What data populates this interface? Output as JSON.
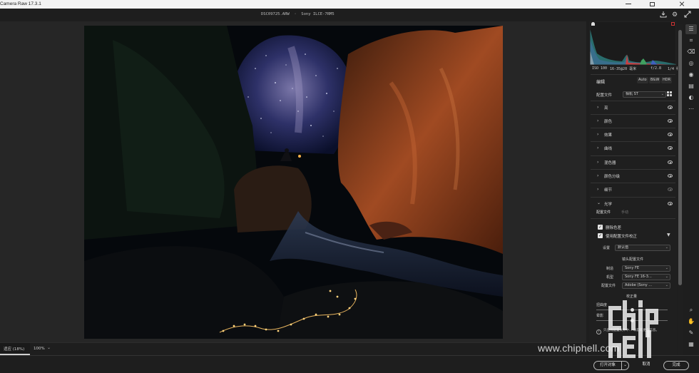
{
  "window": {
    "app_title": "Camera Raw 17.3.1"
  },
  "toolbar": {
    "filename": "DSC09725.ARW  ·  Sony ILCE-7RM5",
    "icons": [
      "save-icon",
      "gear-icon",
      "fullscreen-icon"
    ]
  },
  "histogram": {
    "iso": "ISO 100",
    "focal": "16-35@20 毫米",
    "aperture": "f/2.8",
    "shutter": "1/4 秒"
  },
  "edit_panel": {
    "title": "编辑",
    "buttons": [
      "Auto",
      "B&W",
      "HDR"
    ],
    "profile_label": "配置文件",
    "profile_value": "相机 ST",
    "sections": [
      {
        "label": "亮"
      },
      {
        "label": "颜色"
      },
      {
        "label": "效果"
      },
      {
        "label": "曲线"
      },
      {
        "label": "混色器"
      },
      {
        "label": "颜色分级"
      },
      {
        "label": "细节"
      },
      {
        "label": "光学"
      }
    ],
    "optics": {
      "tab_profile": "配置文件",
      "tab_manual": "手动",
      "remove_ca": "删除色差",
      "use_profile": "使用配置文件校正",
      "setup_label": "设置",
      "setup_value": "默认值",
      "lens_profile_heading": "镜头配置文件",
      "make_label": "制造",
      "make_value": "Sony FE",
      "model_label": "机型",
      "model_value": "Sony FE 16-3…",
      "profile_label": "配置文件",
      "profile_value": "Adobe (Sony …",
      "correction_heading": "校正量",
      "distortion_label": "扭曲度",
      "vignette_label": "晕影",
      "note": "只应用配置文件中… 以获取更多信息。"
    }
  },
  "status_bar": {
    "fit_label": "适应 (18%)",
    "zoom_label": "100%"
  },
  "footer": {
    "open_object": "打开对象",
    "cancel": "取消",
    "done": "完成"
  },
  "watermark": {
    "text": "www.chiphell.com"
  }
}
